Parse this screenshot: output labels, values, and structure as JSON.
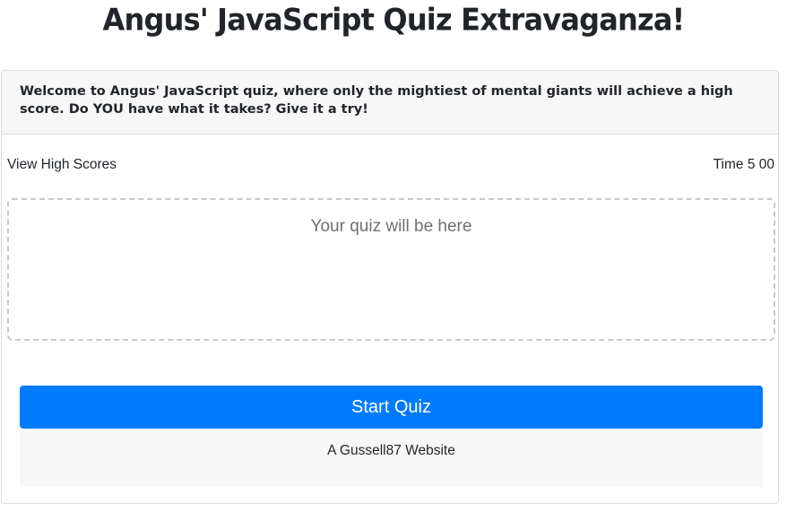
{
  "page": {
    "title": "Angus' JavaScript Quiz Extravaganza!"
  },
  "header": {
    "intro": "Welcome to Angus' JavaScript quiz, where only the mightiest of mental giants will achieve a high score. Do YOU have what it takes? Give it a try!"
  },
  "toolbar": {
    "high_scores_label": "View High Scores",
    "timer_label": "Time",
    "timer_minutes": "5",
    "timer_seconds": "00"
  },
  "quiz": {
    "placeholder": "Your quiz will be here"
  },
  "actions": {
    "start_label": "Start Quiz"
  },
  "footer": {
    "credit": "A Gussell87 Website"
  },
  "colors": {
    "accent": "#007bff",
    "panel_background": "#f7f7f7",
    "border": "#dcdcdc"
  }
}
